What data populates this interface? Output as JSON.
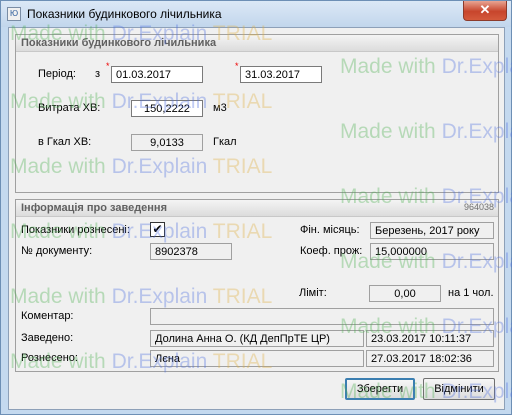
{
  "window": {
    "title": "Показники будинкового лічильника",
    "close_symbol": "✕",
    "app_icon_symbol": "Ю"
  },
  "meter_group": {
    "title": "Показники будинкового лічильника",
    "period_label": "Період:",
    "from_label": "з",
    "required_mark": "*",
    "period_from": "01.03.2017",
    "period_to": "31.03.2017",
    "consumption_label": "Витрата ХВ:",
    "consumption_value": "150,2222",
    "consumption_unit": "м3",
    "gcal_label": "в Гкал ХВ:",
    "gcal_value": "9,0133",
    "gcal_unit": "Гкал"
  },
  "info_group": {
    "title": "Інформація про заведення",
    "code": "964038",
    "posted_label": "Показники рознесені:",
    "posted_checked_symbol": "✔",
    "doc_label": "№ документу:",
    "doc_value": "8902378",
    "fin_month_label": "Фін. місяць:",
    "fin_month_value": "Березень, 2017 року",
    "coef_label": "Коеф. прож:",
    "coef_value": "15,000000",
    "limit_label": "Ліміт:",
    "limit_value": "0,00",
    "limit_suffix": "на 1 чол.",
    "comment_label": "Коментар:",
    "comment_value": "",
    "entered_label": "Заведено:",
    "entered_by": "Долина Анна О. (КД ДепПрТЕ ЦР)",
    "entered_at": "23.03.2017 10:11:37",
    "posted_by_label": "Рознесено:",
    "posted_by": "Лєна",
    "posted_at": "27.03.2017 18:02:36"
  },
  "buttons": {
    "save": "Зберегти",
    "cancel": "Відмінити"
  },
  "watermark": {
    "made": "Made with",
    "dr": "Dr.Explain",
    "trial": "TRIAL"
  }
}
